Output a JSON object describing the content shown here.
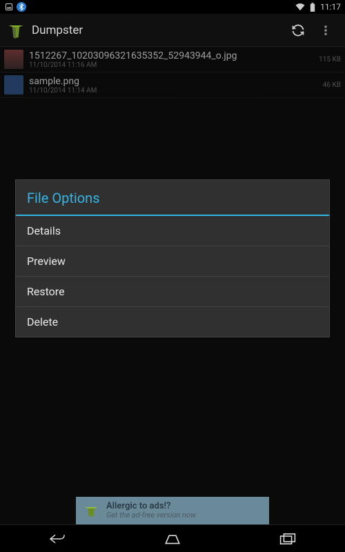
{
  "status_bar": {
    "time": "11:17"
  },
  "action_bar": {
    "title": "Dumpster"
  },
  "files": [
    {
      "name": "1512267_10203096321635352_52943944_o.jpg",
      "date": "11/10/2014 11:16 AM",
      "size": "115 KB"
    },
    {
      "name": "sample.png",
      "date": "11/10/2014 11:14 AM",
      "size": "46 KB"
    }
  ],
  "dialog": {
    "title": "File Options",
    "items": [
      "Details",
      "Preview",
      "Restore",
      "Delete"
    ]
  },
  "ad": {
    "line1": "Allergic to ads!?",
    "line2": "Get the ad-free version now"
  }
}
